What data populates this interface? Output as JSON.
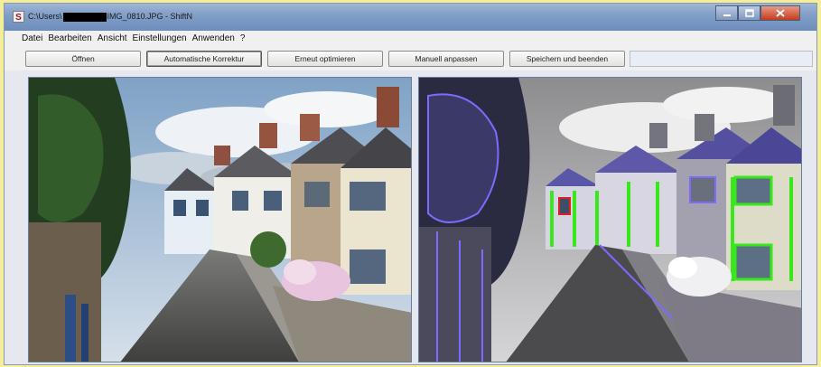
{
  "window": {
    "app_icon": "S",
    "title_prefix": "C:\\Users\\",
    "title_suffix": "IMG_0810.JPG - ShiftN",
    "controls": [
      "minimize-icon",
      "maximize-icon",
      "close-icon"
    ]
  },
  "menu": {
    "items": [
      "Datei",
      "Bearbeiten",
      "Ansicht",
      "Einstellungen",
      "Anwenden",
      "?"
    ]
  },
  "toolbar": {
    "buttons": [
      {
        "label": "Öffnen"
      },
      {
        "label": "Automatische Korrektur"
      },
      {
        "label": "Erneut optimieren"
      },
      {
        "label": "Manuell anpassen"
      },
      {
        "label": "Speichern und beenden"
      }
    ]
  },
  "colors": {
    "titlebar": "#7f9dc6",
    "close_button": "#c43b1e",
    "edge_overlay_blue": "#7a6cff",
    "edge_overlay_green": "#39e81b",
    "edge_overlay_red": "#e02020"
  }
}
